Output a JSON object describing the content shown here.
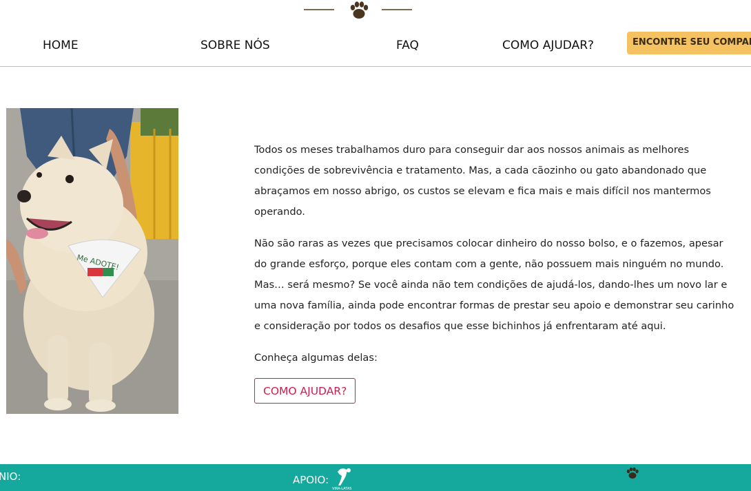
{
  "logo": {
    "icon": "paw-icon",
    "color": "#4a3520"
  },
  "nav": {
    "items": [
      {
        "label": "HOME"
      },
      {
        "label": "SOBRE NÓS"
      },
      {
        "label": "FAQ"
      },
      {
        "label": "COMO AJUDAR?"
      }
    ],
    "cta_label": "ENCONTRE SEU COMPANHEIRO",
    "cta_color": "#f5c261"
  },
  "main": {
    "paragraphs": [
      "Todos os meses trabalhamos duro para conseguir dar aos nossos animais as melhores condições de sobrevivência e tratamento. Mas, a cada cãozinho ou gato abandonado que abraçamos em nosso abrigo, os custos se elevam e fica mais e mais difícil nos mantermos operando.",
      "Não são raras as vezes que precisamos colocar dinheiro do nosso bolso, e o fazemos, apesar do grande esforço, porque eles contam com a gente, não possuem mais ninguém no mundo. Mas… será mesmo? Se você ainda não tem condições de ajudá-los, dando-lhes um novo lar e uma nova família, ainda pode encontrar formas de prestar seu apoio e demonstrar seu carinho e consideração por todos os desafios que esse bichinhos já enfrentaram até aqui.",
      "Conheça algumas delas:"
    ],
    "button_label": "COMO AJUDAR?",
    "button_color": "#d11c4e",
    "photo_bandana_text": "Me ADOTE!"
  },
  "footer": {
    "left_label": "NIO:",
    "apoio_label": "APOIO:",
    "apoio_logo_text": "VIRA-LATAS",
    "background": "#15a99d"
  }
}
